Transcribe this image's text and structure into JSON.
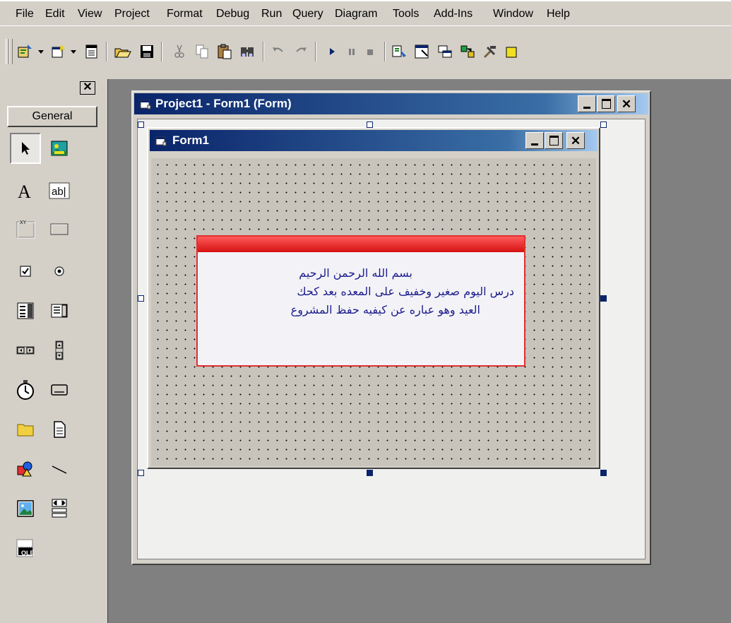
{
  "menu": {
    "items": [
      "File",
      "Edit",
      "View",
      "Project",
      "Format",
      "Debug",
      "Run",
      "Query",
      "Diagram",
      "Tools",
      "Add-Ins",
      "Window",
      "Help"
    ]
  },
  "toolbox": {
    "tab_label": "General",
    "tools": [
      "pointer-icon",
      "picturebox-icon",
      "label-icon",
      "textbox-icon",
      "frame-icon",
      "commandbutton-icon",
      "checkbox-icon",
      "optionbutton-icon",
      "combobox-icon",
      "listbox-icon",
      "hscrollbar-icon",
      "vscrollbar-icon",
      "timer-icon",
      "drivelistbox-icon",
      "dirlistbox-icon",
      "filelistbox-icon",
      "shape-icon",
      "line-icon",
      "image-icon",
      "data-icon",
      "ole-icon"
    ],
    "ole_text": "OLE"
  },
  "designer_window": {
    "title": "Project1 - Form1 (Form)"
  },
  "form": {
    "title": "Form1"
  },
  "note": {
    "line1": "بسم الله الرحمن الرحيم",
    "line2": "درس اليوم صغير وخفيف على المعده بعد كحك",
    "line3": "العيد وهو عباره عن كيفيه حفظ المشروع"
  },
  "colors": {
    "titlebar_start": "#0a246a",
    "titlebar_end": "#a6caf0",
    "note_border": "#e03030",
    "note_text": "#1c1c8c"
  }
}
